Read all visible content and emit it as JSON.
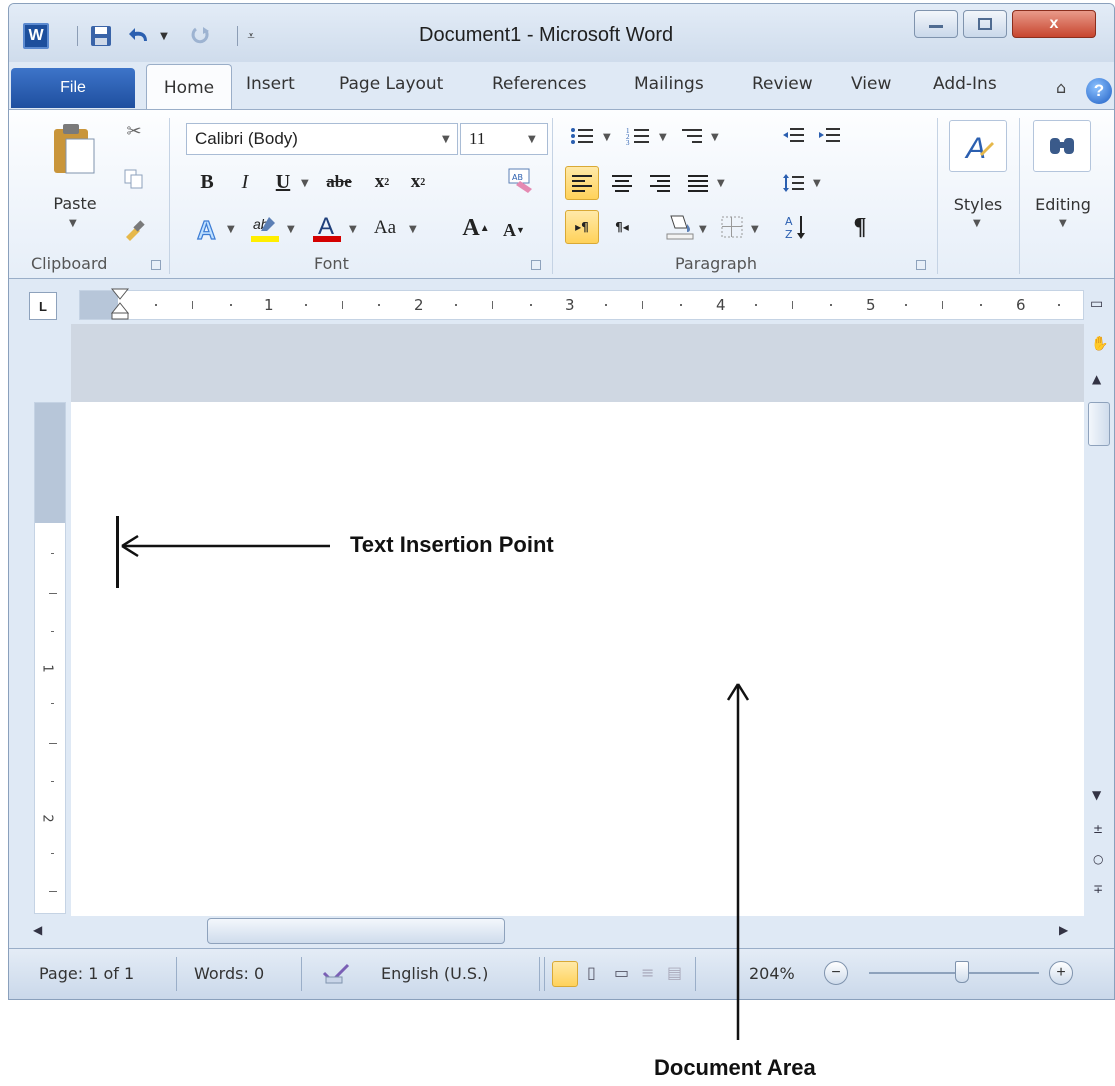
{
  "window": {
    "title": "Document1 - Microsoft Word",
    "close_glyph": "x"
  },
  "tabs": {
    "file": "File",
    "home": "Home",
    "insert": "Insert",
    "page_layout": "Page Layout",
    "references": "References",
    "mailings": "Mailings",
    "review": "Review",
    "view": "View",
    "add_ins": "Add-Ins"
  },
  "clipboard": {
    "paste_label": "Paste",
    "group_label": "Clipboard"
  },
  "font": {
    "name": "Calibri (Body)",
    "size": "11",
    "group_label": "Font",
    "change_case": "Aa"
  },
  "paragraph": {
    "group_label": "Paragraph"
  },
  "styles": {
    "label": "Styles"
  },
  "editing": {
    "label": "Editing"
  },
  "ruler": {
    "numbers": [
      "1",
      "2",
      "3",
      "4",
      "5",
      "6"
    ],
    "v_numbers": [
      "1",
      "2"
    ]
  },
  "status": {
    "page": "Page: 1 of 1",
    "words": "Words: 0",
    "language": "English (U.S.)",
    "zoom": "204%"
  },
  "annotations": {
    "insertion_point": "Text Insertion Point",
    "document_area": "Document Area"
  },
  "colors": {
    "highlight": "#ffd25a",
    "file_tab": "#2a5db0",
    "font_color_bar": "#d40000",
    "highlighter_bar": "#ffee00"
  }
}
